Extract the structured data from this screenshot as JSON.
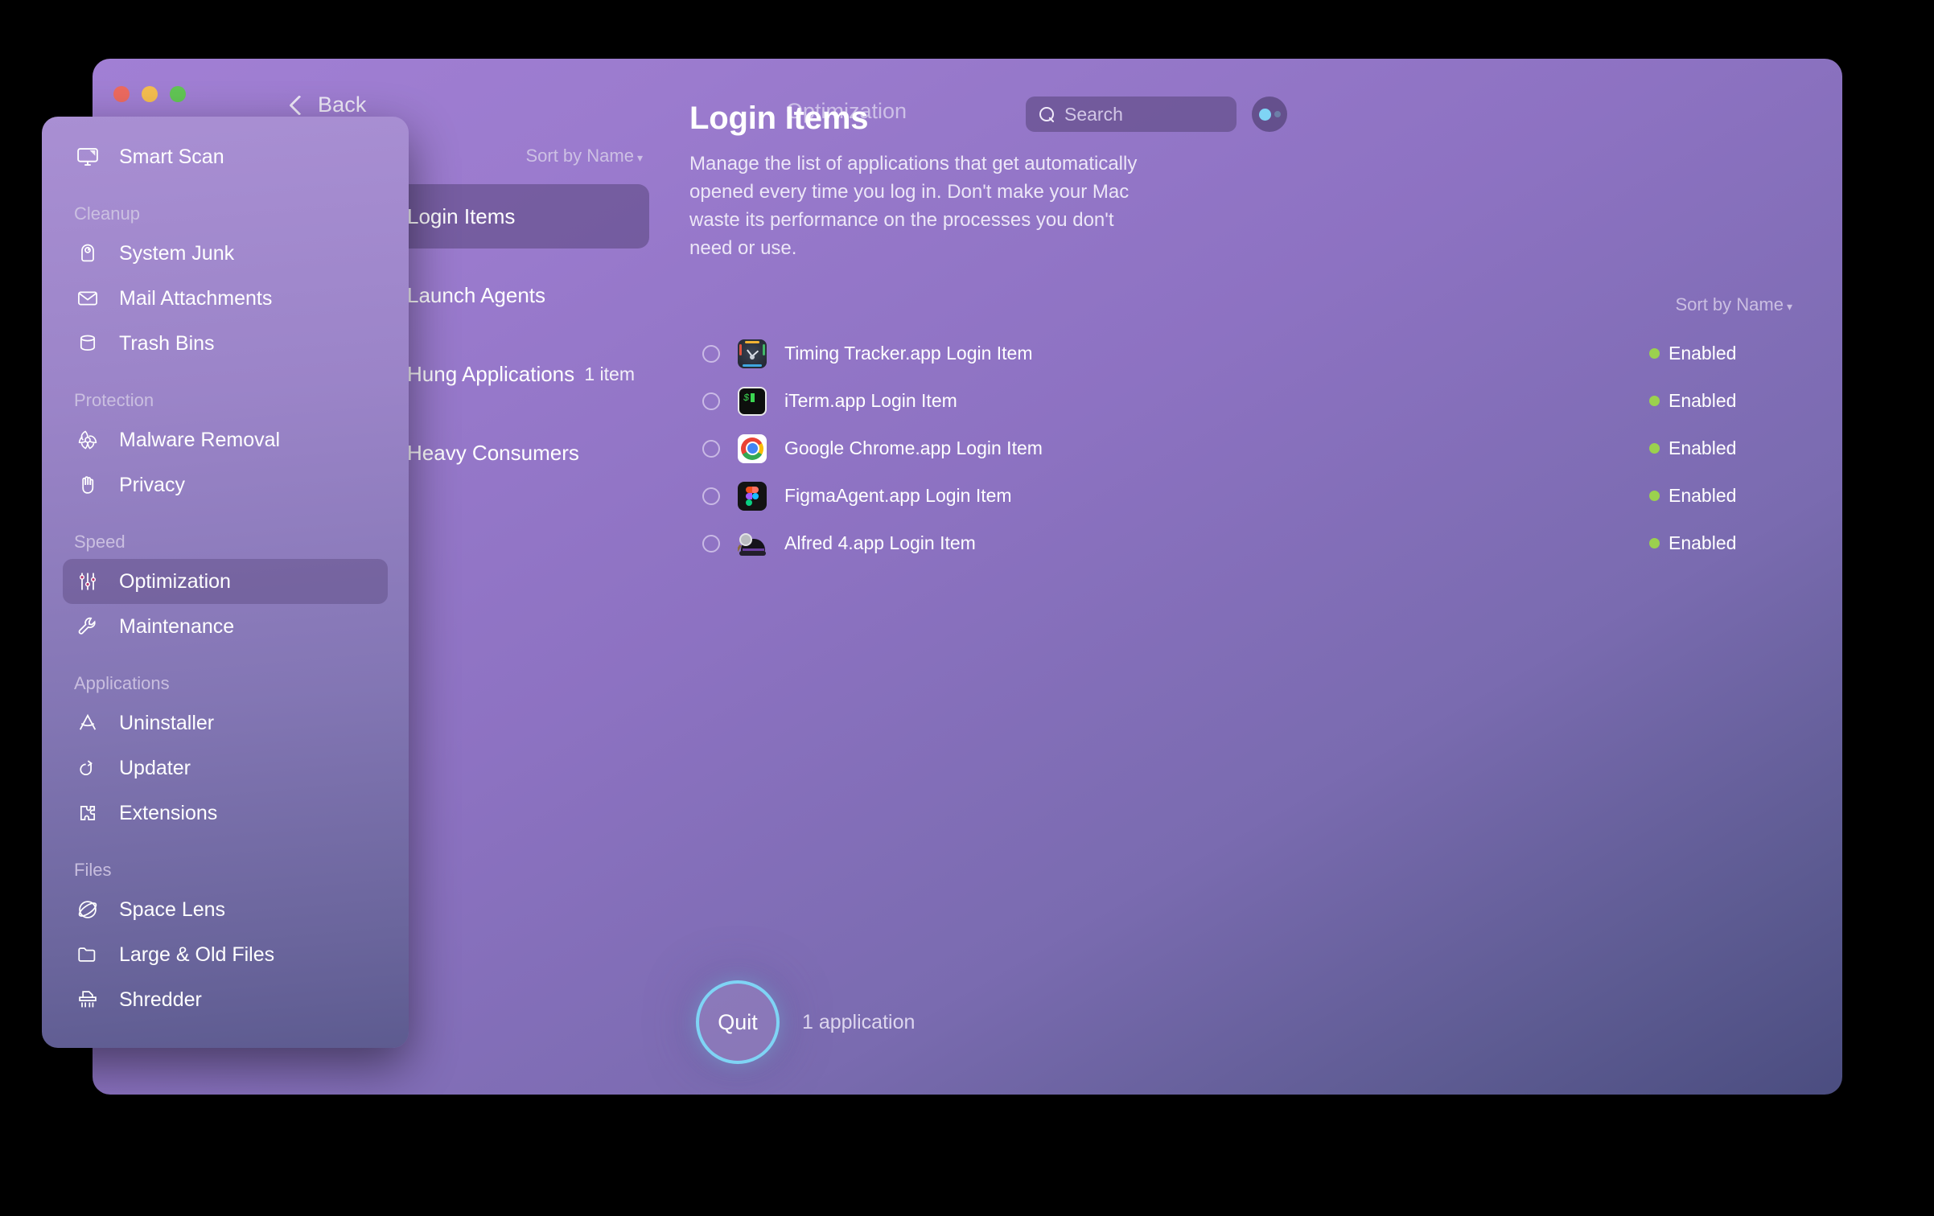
{
  "window": {
    "traffic_lights": [
      "close",
      "minimize",
      "zoom"
    ],
    "back_label": "Back",
    "breadcrumb": "Optimization"
  },
  "search": {
    "placeholder": "Search",
    "value": ""
  },
  "sidebar": {
    "top_item": {
      "label": "Smart Scan",
      "icon": "smart-scan-icon"
    },
    "groups": [
      {
        "title": "Cleanup",
        "items": [
          {
            "label": "System Junk",
            "icon": "system-junk-icon"
          },
          {
            "label": "Mail Attachments",
            "icon": "mail-icon"
          },
          {
            "label": "Trash Bins",
            "icon": "trash-icon"
          }
        ]
      },
      {
        "title": "Protection",
        "items": [
          {
            "label": "Malware Removal",
            "icon": "biohazard-icon"
          },
          {
            "label": "Privacy",
            "icon": "hand-icon"
          }
        ]
      },
      {
        "title": "Speed",
        "items": [
          {
            "label": "Optimization",
            "icon": "sliders-icon",
            "active": true
          },
          {
            "label": "Maintenance",
            "icon": "wrench-icon"
          }
        ]
      },
      {
        "title": "Applications",
        "items": [
          {
            "label": "Uninstaller",
            "icon": "uninstaller-icon"
          },
          {
            "label": "Updater",
            "icon": "updater-icon"
          },
          {
            "label": "Extensions",
            "icon": "puzzle-icon"
          }
        ]
      },
      {
        "title": "Files",
        "items": [
          {
            "label": "Space Lens",
            "icon": "space-lens-icon"
          },
          {
            "label": "Large & Old Files",
            "icon": "folder-icon"
          },
          {
            "label": "Shredder",
            "icon": "shredder-icon"
          }
        ]
      }
    ]
  },
  "middle": {
    "sort_label": "Sort by Name",
    "sort_caret": "▾",
    "items": [
      {
        "label": "Login Items",
        "icon": "power-icon",
        "checkbox": "empty",
        "count": "",
        "selected": true
      },
      {
        "label": "Launch Agents",
        "icon": "rocket-icon",
        "checkbox": "dim",
        "count": "",
        "selected": false
      },
      {
        "label": "Hung Applications",
        "icon": "hourglass-icon",
        "checkbox": "checked",
        "count": "1 item",
        "selected": false
      },
      {
        "label": "Heavy Consumers",
        "icon": "chart-icon",
        "checkbox": "empty",
        "count": "",
        "selected": false
      }
    ]
  },
  "detail": {
    "title": "Login Items",
    "description": "Manage the list of applications that get automatically opened every time you log in. Don't make your Mac waste its performance on the processes you don't need or use.",
    "sort_label": "Sort by Name",
    "sort_caret": "▾",
    "rows": [
      {
        "name": "Timing Tracker.app Login Item",
        "icon": "timing-app-icon",
        "status": "Enabled",
        "checked": false
      },
      {
        "name": "iTerm.app Login Item",
        "icon": "iterm-app-icon",
        "status": "Enabled",
        "checked": false
      },
      {
        "name": "Google Chrome.app Login Item",
        "icon": "chrome-app-icon",
        "status": "Enabled",
        "checked": false
      },
      {
        "name": "FigmaAgent.app Login Item",
        "icon": "figma-app-icon",
        "status": "Enabled",
        "checked": false
      },
      {
        "name": "Alfred 4.app Login Item",
        "icon": "alfred-app-icon",
        "status": "Enabled",
        "checked": false
      }
    ]
  },
  "footer": {
    "quit_label": "Quit",
    "count_label": "1 application"
  },
  "colors": {
    "accent_cyan": "#7fd4f5",
    "status_green": "#9bd14e",
    "power_orange": "#ef7a2f",
    "traffic_red": "#ec6a5f",
    "traffic_yellow": "#f4bd4f",
    "traffic_green": "#61c554"
  }
}
